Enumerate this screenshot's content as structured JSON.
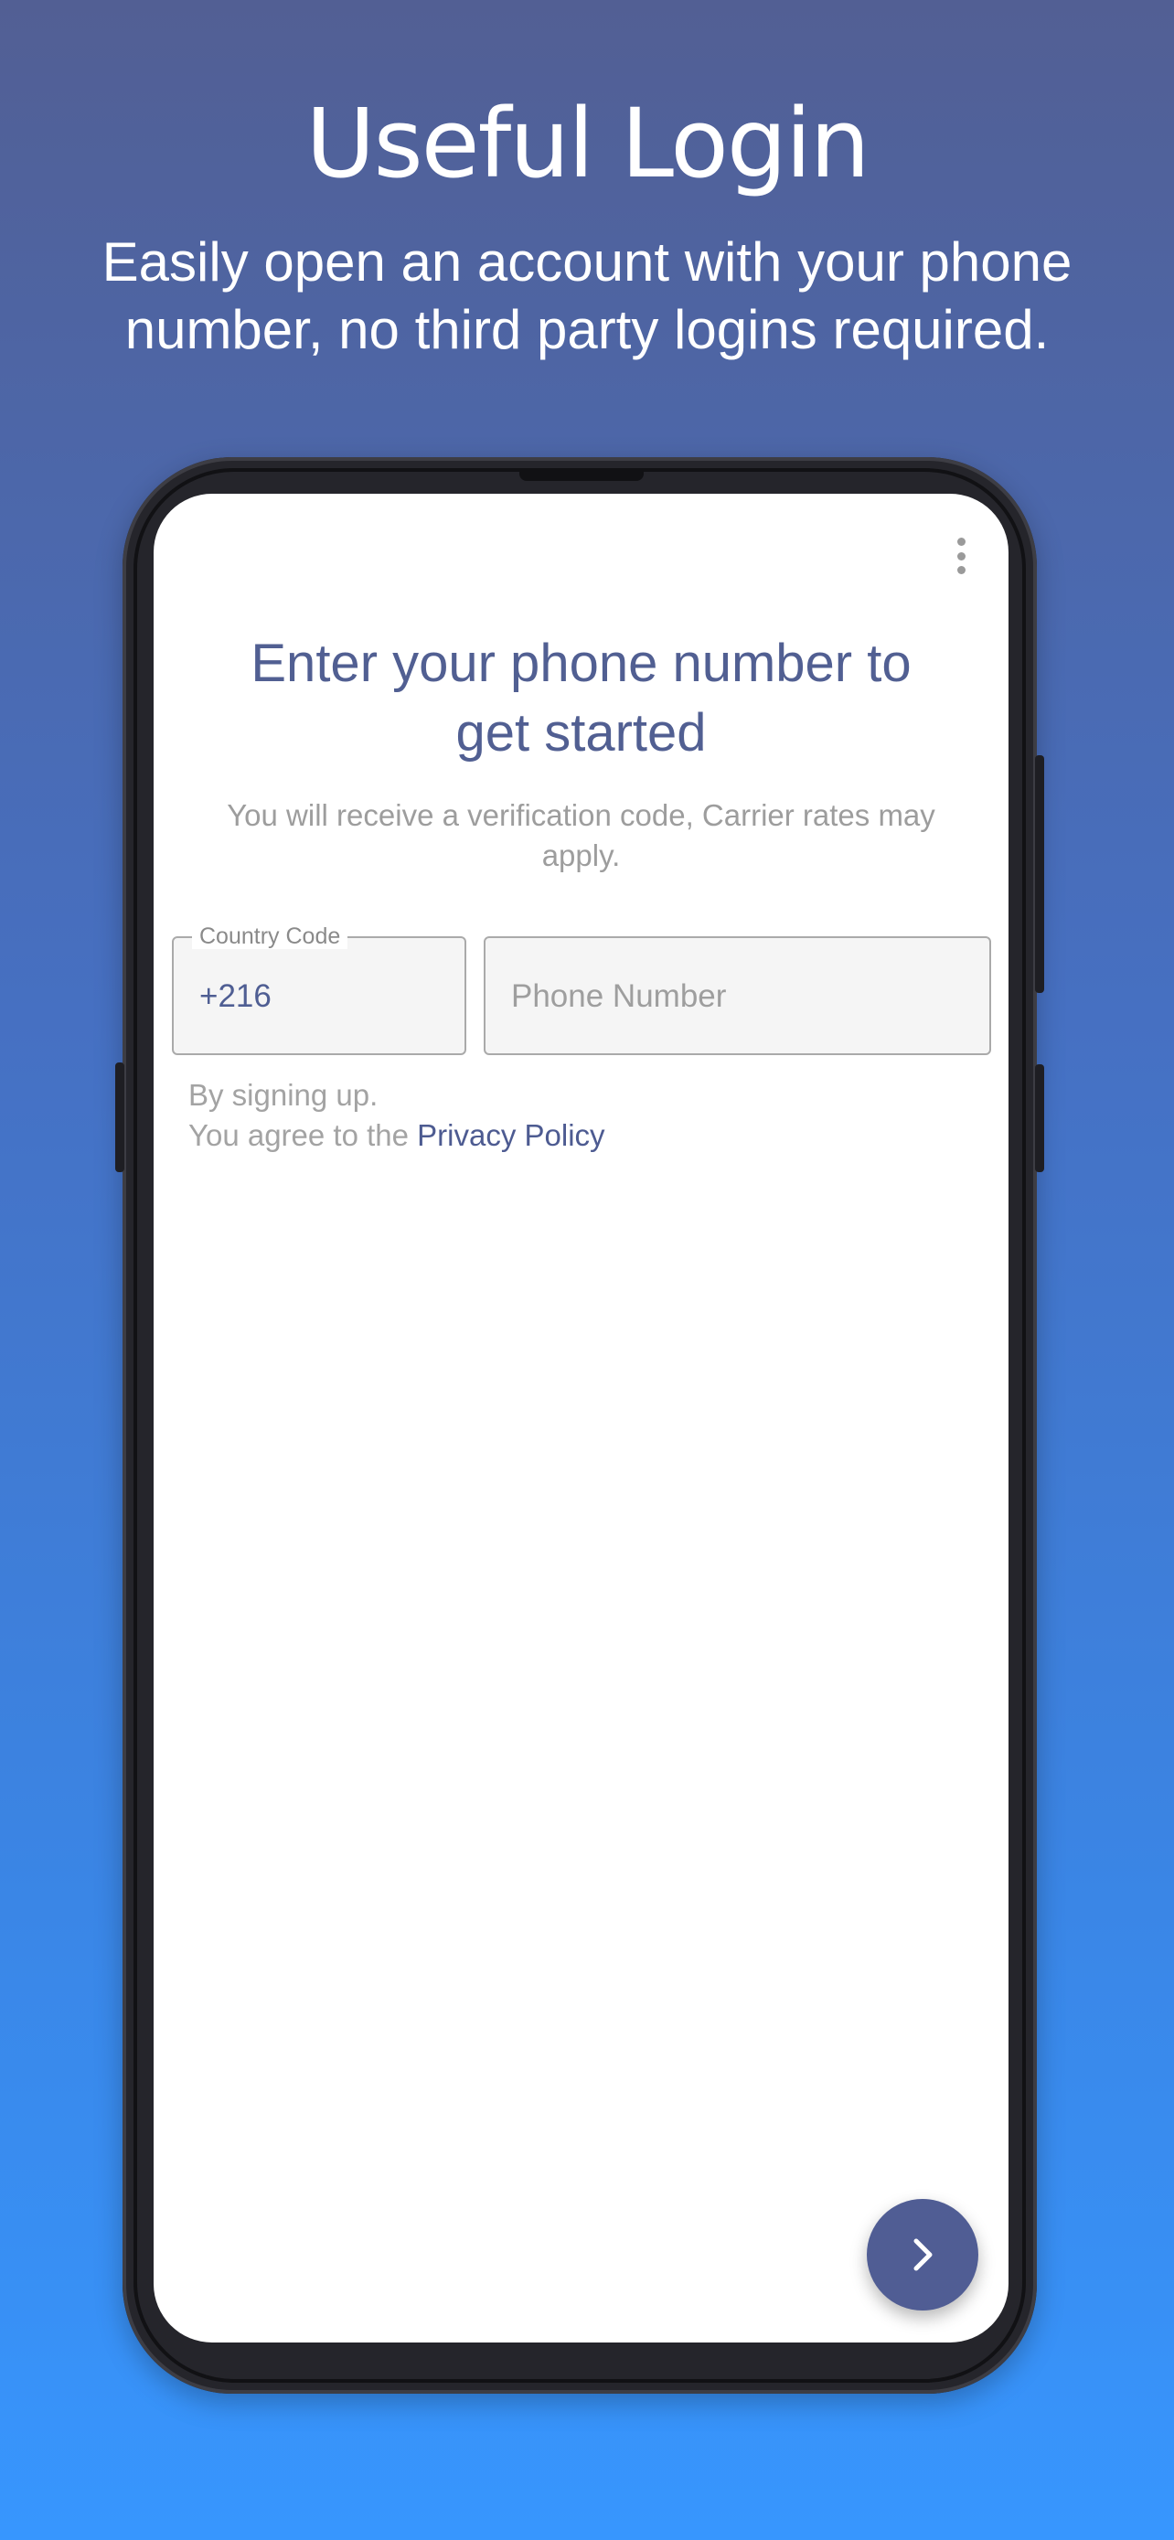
{
  "header": {
    "title": "Useful Login",
    "subtitle": "Easily open an account with your phone number, no third party logins required."
  },
  "screen": {
    "title": "Enter your phone number to get started",
    "subtitle": "You will receive a verification code, Carrier rates may apply.",
    "country_code": {
      "label": "Country Code",
      "value": "+216"
    },
    "phone_number": {
      "placeholder": "Phone Number",
      "value": ""
    },
    "terms": {
      "line1": "By signing up.",
      "line2_prefix": "You agree to the",
      "link": "Privacy Policy"
    },
    "menu_icon": "more-vert-icon",
    "fab_icon": "chevron-right-icon"
  },
  "colors": {
    "accent": "#515f92",
    "background_top": "#525f94",
    "background_bottom": "#3796fe"
  }
}
